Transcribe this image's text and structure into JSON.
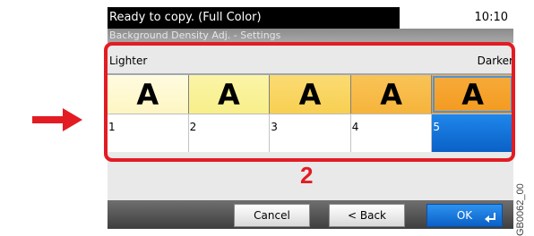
{
  "status": {
    "message": "Ready to copy. (Full Color)",
    "time": "10:10"
  },
  "screen_title": "Background Density Adj. - Settings",
  "scale": {
    "lighter_label": "Lighter",
    "darker_label": "Darker"
  },
  "swatch_letter": "A",
  "swatch_colors": [
    "#fdf6c2",
    "#f8ef8a",
    "#f7cf52",
    "#f6b43b",
    "#f39a1f"
  ],
  "levels": [
    {
      "label": "1",
      "selected": false
    },
    {
      "label": "2",
      "selected": false
    },
    {
      "label": "3",
      "selected": false
    },
    {
      "label": "4",
      "selected": false
    },
    {
      "label": "5",
      "selected": true
    }
  ],
  "callout_number": "2",
  "buttons": {
    "cancel": "Cancel",
    "back": "< Back",
    "ok": "OK"
  },
  "figure_code": "GB0062_00",
  "colors": {
    "highlight_red": "#e31b23",
    "selected_blue": "#0a61c7"
  }
}
